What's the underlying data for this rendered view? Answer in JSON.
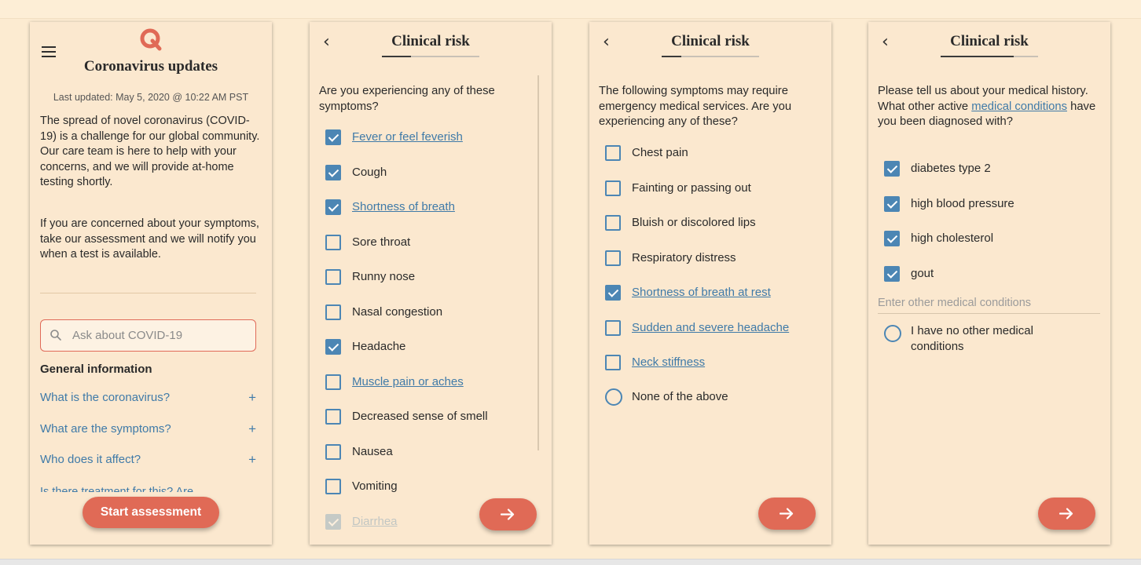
{
  "colors": {
    "accent": "#e06a56",
    "link": "#3f7aa8",
    "checkbox": "#4c86b4",
    "background": "#fbe8cf"
  },
  "screen1": {
    "menu_icon": "hamburger-icon",
    "logo_icon": "app-logo",
    "title": "Coronavirus updates",
    "last_updated": "Last updated: May 5, 2020 @ 10:22 AM PST",
    "paragraph1": "The spread of novel coronavirus (COVID-19) is a challenge for our global community. Our care team is here to help with your concerns, and we will provide at-home testing shortly.",
    "paragraph2": "If you are concerned about your symptoms, take our assessment and we will notify you when a test is available.",
    "search": {
      "icon": "search-icon",
      "placeholder": "Ask about COVID-19"
    },
    "general_title": "General information",
    "faqs": [
      {
        "label": "What is the coronavirus?",
        "icon": "+"
      },
      {
        "label": "What are the symptoms?",
        "icon": "+"
      },
      {
        "label": "Who does it affect?",
        "icon": "+"
      }
    ],
    "faq_partial": "Is there treatment for this? Are",
    "start_button": "Start assessment"
  },
  "screen2": {
    "back": "‹",
    "title": "Clinical risk",
    "progress": 0.3,
    "question": "Are you experiencing any of these symptoms?",
    "options": [
      {
        "label": "Fever or feel feverish",
        "checked": true,
        "link": true
      },
      {
        "label": "Cough",
        "checked": true,
        "link": false
      },
      {
        "label": "Shortness of breath",
        "checked": true,
        "link": true
      },
      {
        "label": "Sore throat",
        "checked": false,
        "link": false
      },
      {
        "label": "Runny nose",
        "checked": false,
        "link": false
      },
      {
        "label": "Nasal congestion",
        "checked": false,
        "link": false
      },
      {
        "label": "Headache",
        "checked": true,
        "link": false
      },
      {
        "label": "Muscle pain or aches",
        "checked": false,
        "link": true
      },
      {
        "label": "Decreased sense of smell",
        "checked": false,
        "link": false
      },
      {
        "label": "Nausea",
        "checked": false,
        "link": false
      },
      {
        "label": "Vomiting",
        "checked": false,
        "link": false
      },
      {
        "label": "Diarrhea",
        "checked": true,
        "link": true
      }
    ],
    "next_icon": "arrow-right-icon"
  },
  "screen3": {
    "back": "‹",
    "title": "Clinical risk",
    "progress": 0.2,
    "question": "The following symptoms may require emergency medical services. Are you experiencing any of these?",
    "options": [
      {
        "label": "Chest pain",
        "checked": false,
        "link": false
      },
      {
        "label": "Fainting or passing out",
        "checked": false,
        "link": false
      },
      {
        "label": "Bluish or discolored lips",
        "checked": false,
        "link": false
      },
      {
        "label": "Respiratory distress",
        "checked": false,
        "link": false
      },
      {
        "label": "Shortness of breath at rest",
        "checked": true,
        "link": true
      },
      {
        "label": "Sudden and severe headache",
        "checked": false,
        "link": true
      },
      {
        "label": "Neck stiffness",
        "checked": false,
        "link": true
      }
    ],
    "none_option": "None of the above",
    "next_icon": "arrow-right-icon"
  },
  "screen4": {
    "back": "‹",
    "title": "Clinical risk",
    "progress": 0.75,
    "question_before": "Please tell us about your medical history. What other active ",
    "question_link": "medical conditions",
    "question_after": " have you been diagnosed with?",
    "options": [
      {
        "label": "diabetes type 2",
        "checked": true
      },
      {
        "label": "high blood pressure",
        "checked": true
      },
      {
        "label": "high cholesterol",
        "checked": true
      },
      {
        "label": "gout",
        "checked": true
      }
    ],
    "other_placeholder": "Enter other medical conditions",
    "no_other_option": "I have no other medical conditions",
    "next_icon": "arrow-right-icon"
  }
}
